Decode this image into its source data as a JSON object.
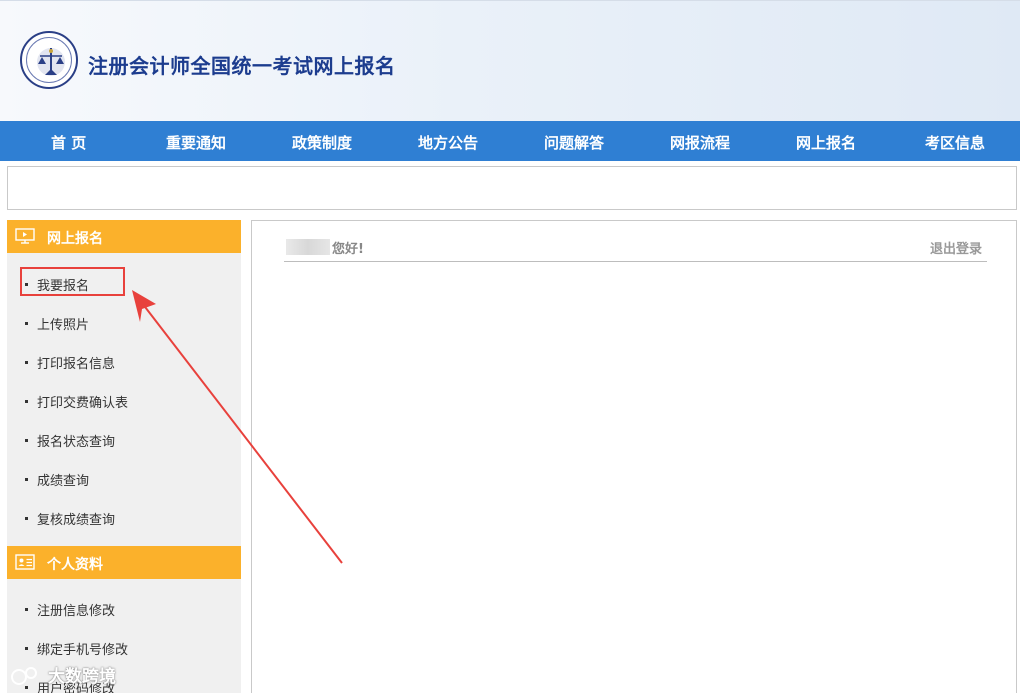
{
  "header": {
    "title": "注册会计师全国统一考试网上报名"
  },
  "nav": {
    "items": [
      "首 页",
      "重要通知",
      "政策制度",
      "地方公告",
      "问题解答",
      "网报流程",
      "网上报名",
      "考区信息"
    ]
  },
  "sidebar": {
    "section1": {
      "title": "网上报名",
      "icon": "monitor-icon",
      "items": [
        "我要报名",
        "上传照片",
        "打印报名信息",
        "打印交费确认表",
        "报名状态查询",
        "成绩查询",
        "复核成绩查询"
      ]
    },
    "section2": {
      "title": "个人资料",
      "icon": "id-card-icon",
      "items": [
        "注册信息修改",
        "绑定手机号修改",
        "用户密码修改"
      ]
    }
  },
  "main": {
    "greeting": "您好!",
    "logout": "退出登录"
  },
  "annotation": {
    "highlight_color": "#e8413c"
  },
  "watermark": {
    "text": "大数跨境"
  },
  "colors": {
    "nav_bg": "#2f7fd3",
    "sidebar_head": "#fbb12b",
    "title": "#1c3c8e"
  }
}
